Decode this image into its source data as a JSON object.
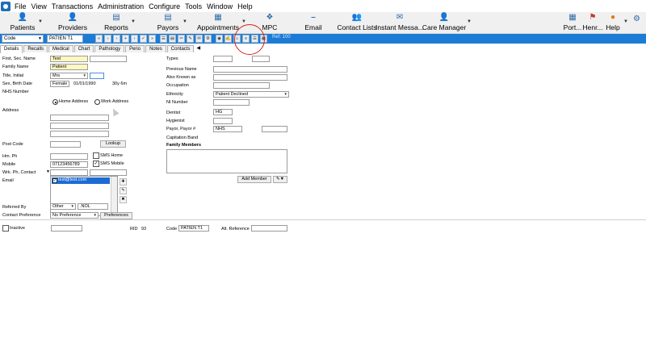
{
  "menu": [
    "File",
    "View",
    "Transactions",
    "Administration",
    "Configure",
    "Tools",
    "Window",
    "Help"
  ],
  "toolbar": {
    "patients": "Patients",
    "providers": "Providers",
    "reports": "Reports",
    "payors": "Payors",
    "appointments": "Appointments",
    "mpc": "MPC",
    "email": "Email",
    "contact_lists": "Contact Lists",
    "instant_messaging": "Instant Messa...",
    "care_manager": "Care Manager",
    "port": "Port...",
    "henr": "Henr...",
    "help": "Help"
  },
  "patient_toolbar": {
    "code_label": "Code",
    "code_value": "PATIEN T1",
    "icons": [
      "«",
      "‹",
      "‹",
      "+",
      "›",
      "✓",
      "»",
      "☰",
      "▤",
      "✂",
      "✎",
      "✉",
      "⚙",
      "◉",
      "✍",
      "⌂",
      "≡",
      "☰",
      "▦"
    ],
    "tag": "Ref: 100"
  },
  "tabs": [
    "Details",
    "Recalls",
    "Medical",
    "Chart",
    "Pathology",
    "Perio",
    "Notes",
    "Contacts"
  ],
  "form": {
    "first_sec_name_label": "First, Sec. Name",
    "first_name": "Test",
    "second_name": "",
    "family_name_label": "Family Name",
    "family_name": "Patient",
    "title_initial_label": "Title, Initial",
    "title": "Mrs",
    "initial": "",
    "sex_birth_label": "Sex, Birth Date",
    "sex": "Female",
    "birth_date": "01/01/1990",
    "age": "30y 6m",
    "nhs_label": "NHS Number",
    "nhs_number": "",
    "home_address": "Home Address",
    "work_address": "Work Address",
    "address_label": "Address",
    "address_1": "",
    "address_2": "",
    "address_3": "",
    "post_code_label": "Post Code",
    "post_code": "",
    "lookup": "Lookup",
    "hm_ph_label": "Hm. Ph",
    "hm_ph": "",
    "sms_home": "SMS Home",
    "mobile_label": "Mobile",
    "mobile": "07123456789",
    "sms_mobile": "SMS Mobile",
    "wrk_ph_label": "Wrk. Ph, Contact",
    "wrk_ph": "",
    "contact": "",
    "email_label": "Email",
    "email": "test@test.com",
    "referred_by_label": "Referred By",
    "referred_by": "Other",
    "referred_by_code": ".NOL",
    "contact_pref_label": "Contact Preference",
    "contact_pref": "No Preference",
    "preferences": "Preferences",
    "types_label": "Types",
    "previous_name_label": "Previous Name",
    "also_known_label": "Also Known as",
    "occupation_label": "Occupation",
    "ethnicity_label": "Ethnicity",
    "ethnicity": "Patient Declined",
    "ni_label": "NI Number",
    "dentist_label": "Dentist",
    "dentist": "HG",
    "hygienist_label": "Hygienist",
    "hygienist": "",
    "payor_label": "Payor, Payor #",
    "payor": "NHS",
    "payor_number": "",
    "capitation_label": "Capitation Band",
    "family_members_label": "Family Members",
    "add_member": "Add Member",
    "inactive": "Inactive",
    "rid_label": "RID",
    "rid_value": "93",
    "code_label": "Code",
    "code_value": "PATIEN T1",
    "alt_ref_label": "Alt. Reference"
  }
}
